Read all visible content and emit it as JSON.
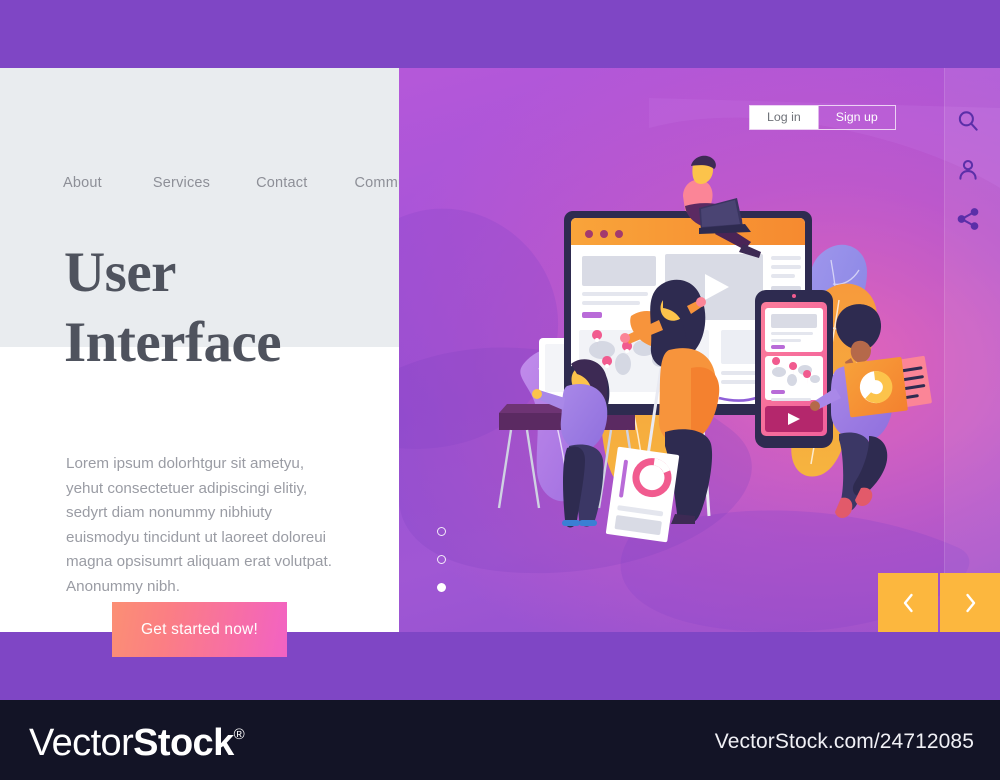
{
  "theme": {
    "band_purple": "#7f46c5",
    "panel_gray": "#e9ecef",
    "panel_white": "#ffffff",
    "heading_color": "#4f535e",
    "body_text_color": "#9a9ca4",
    "nav_color": "#8d8f97",
    "cta_gradient_from": "#fb8f74",
    "cta_gradient_to": "#f262c4",
    "arrow_amber": "#fcb73e",
    "footer_bg": "#131426",
    "hero_purple": "#9b53d6",
    "hero_pink": "#f068b4",
    "leaf_orange": "#f79a3c",
    "leaf_violet": "#b07ae0",
    "leaf_blue": "#8f8fe8",
    "accent_magenta": "#ef5aa0"
  },
  "nav": {
    "items": [
      {
        "label": "About"
      },
      {
        "label": "Services"
      },
      {
        "label": "Contact"
      },
      {
        "label": "Community"
      }
    ]
  },
  "hero_text": {
    "headline_line1": "User",
    "headline_line2": "Interface",
    "paragraph": "Lorem ipsum dolorhtgur sit ametyu, yehut consectetuer adipiscingi elitiy, sedyrt diam nonummy nibhiuty euismodyu tincidunt ut laoreet doloreui magna opsisumrt aliquam erat volutpat. Anonummy nibh.",
    "cta_label": "Get started now!"
  },
  "auth": {
    "login_label": "Log in",
    "signup_label": "Sign up"
  },
  "rail": {
    "icons": [
      {
        "name": "search-icon"
      },
      {
        "name": "user-icon"
      },
      {
        "name": "share-icon"
      }
    ]
  },
  "carousel": {
    "dots": [
      {
        "active": false
      },
      {
        "active": false
      },
      {
        "active": true
      }
    ],
    "prev_glyph": "‹",
    "next_glyph": "›"
  },
  "illustration": {
    "alt": "People building a user interface: a person on a laptop sits atop a desktop browser window, a woman points at the screen from a ladder, a woman works at a desk monitor, and a person carries a chart card beside a smartphone mockup",
    "browser": {
      "dot_count": 3,
      "has_video_player": true,
      "has_world_map": true,
      "map_pin_count": 4
    },
    "phone": {
      "has_world_map": true,
      "map_pin_count": 3,
      "has_video_player": true
    },
    "chart_card": {
      "type": "donut"
    },
    "document_card": {
      "type": "donut"
    }
  },
  "footer": {
    "logo_thin": "Vector",
    "logo_bold": "Stock",
    "logo_reg": "®",
    "url": "VectorStock.com/24712085"
  }
}
